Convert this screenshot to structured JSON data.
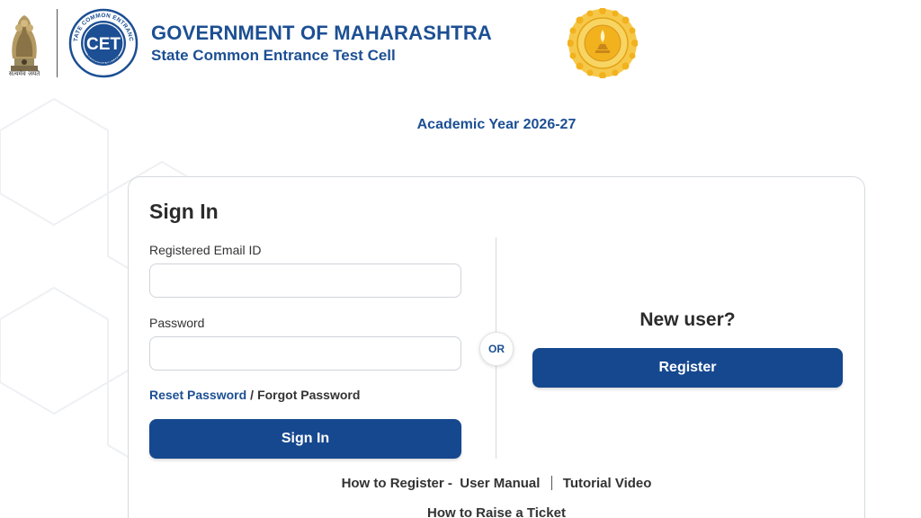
{
  "header": {
    "emblem_caption": "सत्यमेव जयते",
    "cet_logo_text": "CET",
    "cet_logo_ring_top": "STATE COMMON ENTRANCE",
    "cet_logo_ring_bottom": "MAHARASHTRA",
    "title": "GOVERNMENT OF MAHARASHTRA",
    "subtitle": "State Common Entrance Test Cell"
  },
  "academic_year": "Academic Year 2026-27",
  "signin": {
    "title": "Sign In",
    "email_label": "Registered Email ID",
    "email_value": "",
    "password_label": "Password",
    "password_value": "",
    "reset_password": "Reset Password",
    "separator": "/",
    "forgot_password": "Forgot Password",
    "button": "Sign In"
  },
  "divider_text": "OR",
  "register": {
    "heading": "New user?",
    "button": "Register"
  },
  "help": {
    "how_to_register": "How to Register -",
    "user_manual": "User Manual",
    "tutorial_video": "Tutorial Video",
    "raise_ticket": "How to Raise a Ticket"
  },
  "colors": {
    "brand_blue": "#1c4f93",
    "button_blue": "#16488f",
    "seal_gold": "#f2b21e"
  }
}
